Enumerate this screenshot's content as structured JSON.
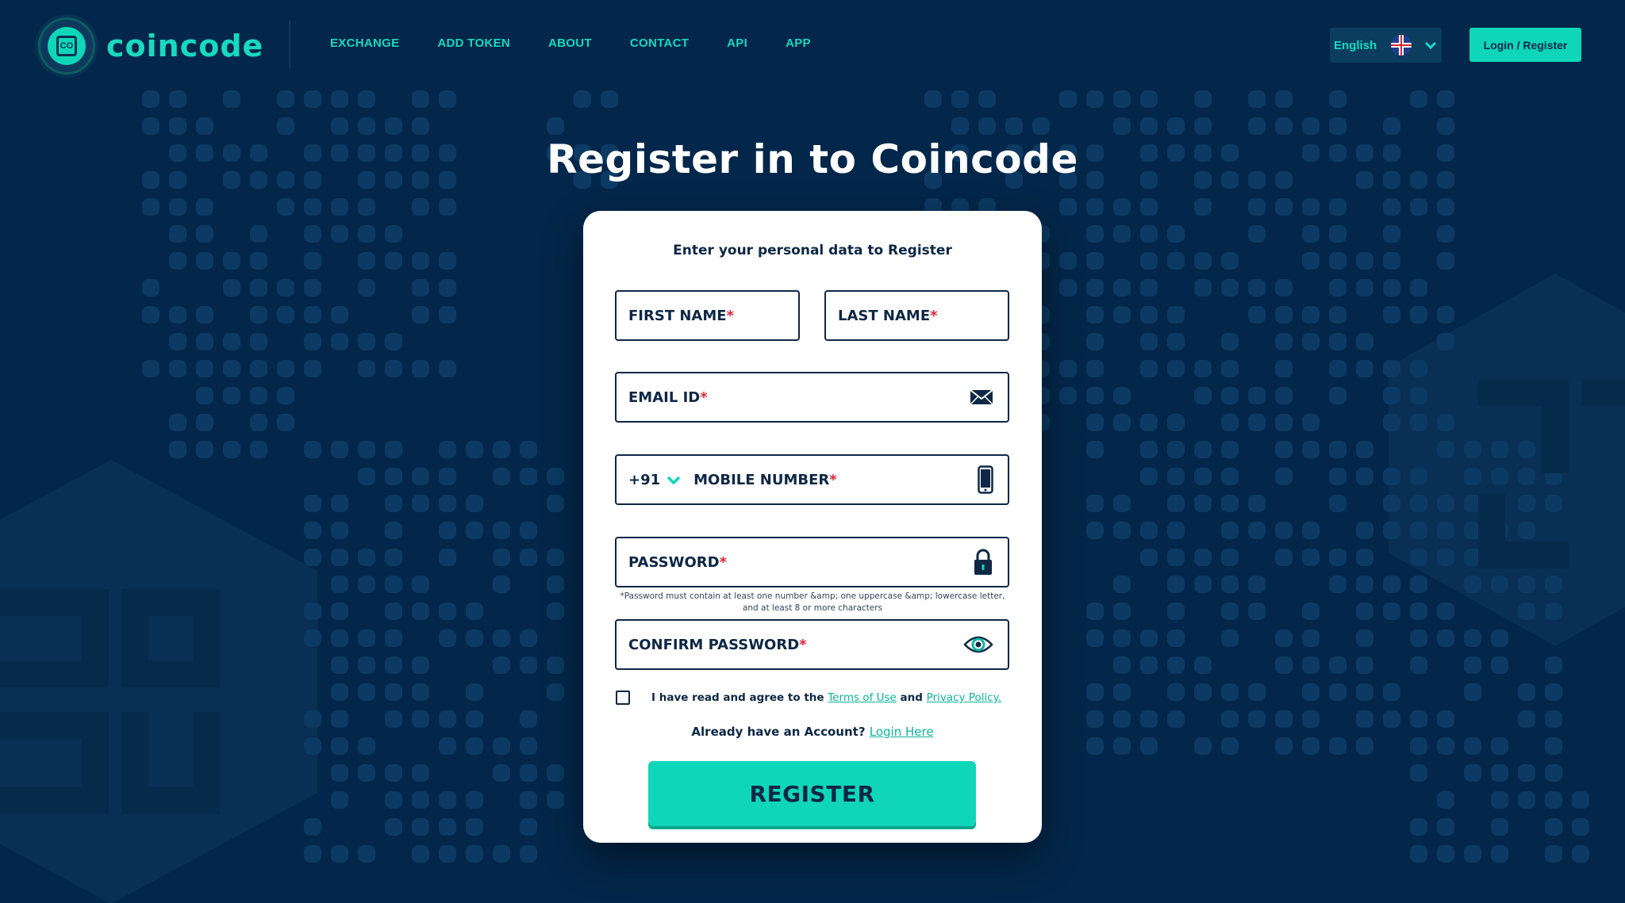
{
  "brand": {
    "name": "coincode",
    "accent_color": "#0fd6b9",
    "background_color": "#03274a"
  },
  "nav": {
    "items": [
      "EXCHANGE",
      "ADD TOKEN",
      "ABOUT",
      "CONTACT",
      "API",
      "APP"
    ]
  },
  "header": {
    "language": {
      "label": "English",
      "flag": "uk-flag-icon",
      "chevron": "chevron-down-icon"
    },
    "login_label": "Login / Register"
  },
  "page_title": "Register in to Coincode",
  "form": {
    "subtitle": "Enter your personal data to Register",
    "first_name": "FIRST NAME",
    "last_name": "LAST NAME",
    "email": "EMAIL ID",
    "email_icon": "envelope-icon",
    "country_code": "+91",
    "mobile": "MOBILE NUMBER",
    "mobile_icon": "smartphone-icon",
    "password": "PASSWORD",
    "password_icon": "lock-icon",
    "password_hint": "*Password must contain at least one number &amp; one uppercase &amp; lowercase letter, and at least 8 or more characters",
    "confirm_password": "CONFIRM PASSWORD",
    "confirm_icon": "eye-icon",
    "required_mark": "*",
    "agree_prefix": "I have read and agree to the ",
    "terms_link": "Terms of Use",
    "agree_and": " and ",
    "privacy_link": "Privacy Policy.",
    "already_text": "Already have an Account? ",
    "login_here": "Login Here",
    "register_label": "REGISTER"
  }
}
